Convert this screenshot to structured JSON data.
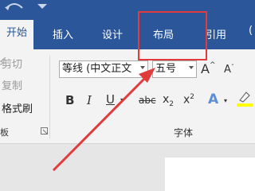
{
  "tabs": [
    "开始",
    "插入",
    "设计",
    "布局",
    "引用"
  ],
  "clipboard": {
    "cut": "剪切",
    "copy": "复制",
    "format_painter": "格式刷",
    "group_fragment": "板"
  },
  "font": {
    "name": "等线 (中文正文",
    "size": "五号",
    "group_label": "字体"
  },
  "buttons": {
    "grow_font": "A",
    "shrink_font": "A",
    "bold": "B",
    "italic": "I",
    "underline": "U",
    "strike": "abc",
    "subscript_base": "x",
    "subscript": "2",
    "superscript_base": "x",
    "superscript": "2",
    "text_effects": "A",
    "highlight": "ab"
  },
  "colors": {
    "accent": "#2b579a",
    "annotation": "#e23b3b",
    "ribbon": "#f3f3f3"
  }
}
